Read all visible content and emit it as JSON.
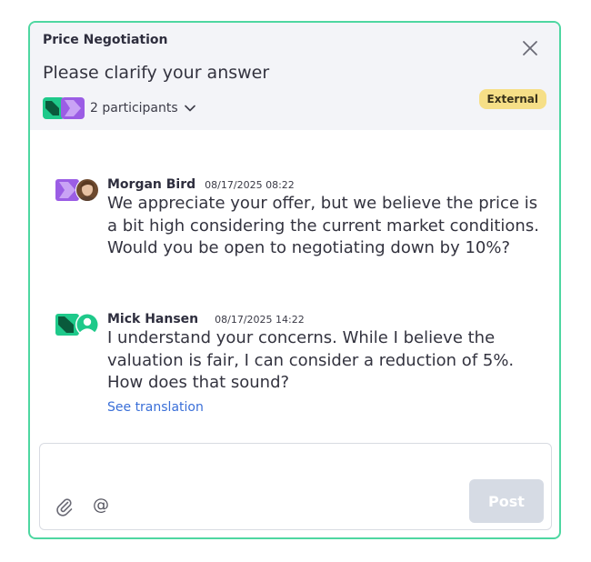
{
  "header": {
    "topic": "Price Negotiation",
    "title": "Please clarify your answer",
    "participants_label": "2 participants",
    "badge": "External"
  },
  "messages": [
    {
      "author": "Morgan Bird",
      "time": "08/17/2025 08:22",
      "text": "We appreciate your offer, but we believe the price is a bit high considering the current market conditions. Would you be open to negotiating down by 10%?"
    },
    {
      "author": "Mick Hansen",
      "time": "08/17/2025 14:22",
      "text": "I understand your concerns. While I believe the valuation is fair, I can consider a reduction of 5%. How does that sound?",
      "translate_link": "See translation"
    }
  ],
  "composer": {
    "post_label": "Post",
    "mention_symbol": "@"
  },
  "colors": {
    "accent_border": "#4ed7a1",
    "brand_green": "#1ec98a",
    "brand_purple": "#9b5de5",
    "badge_bg": "#f6df87",
    "link": "#3a6fd8"
  },
  "icons": [
    "close-icon",
    "chevron-down-icon",
    "paperclip-icon",
    "at-icon",
    "company-logo-icon",
    "user-icon"
  ]
}
